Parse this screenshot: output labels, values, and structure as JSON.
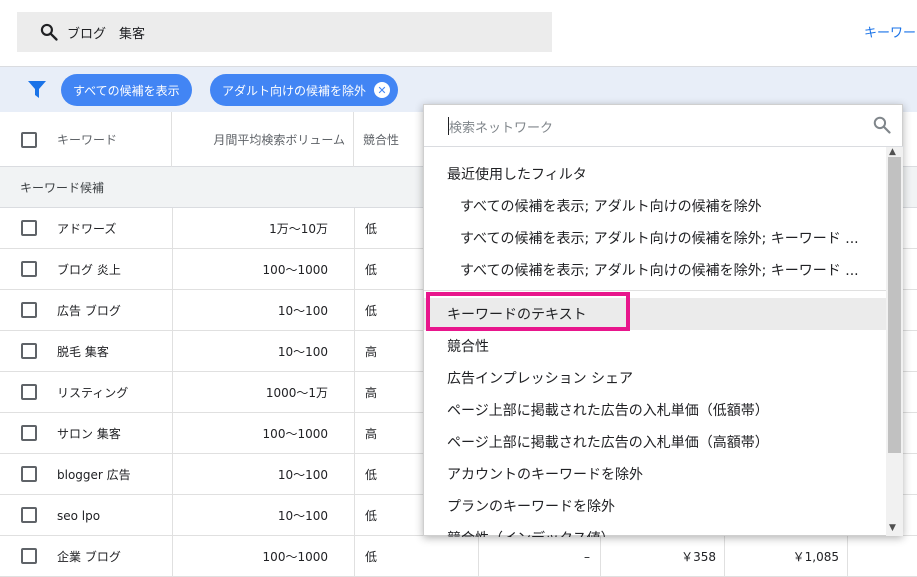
{
  "search": {
    "query": "ブログ　集客"
  },
  "top_link": "キーワー",
  "filters": {
    "chips": [
      "すべての候補を表示",
      "アダルト向けの候補を除外"
    ]
  },
  "table": {
    "headers": [
      "キーワード",
      "月間平均検索ボリューム",
      "競合性"
    ],
    "section_label": "キーワード候補",
    "rows": [
      {
        "keyword": "アドワーズ",
        "volume": "1万～10万",
        "competition": "低"
      },
      {
        "keyword": "ブログ 炎上",
        "volume": "100～1000",
        "competition": "低"
      },
      {
        "keyword": "広告 ブログ",
        "volume": "10～100",
        "competition": "低"
      },
      {
        "keyword": "脱毛 集客",
        "volume": "10～100",
        "competition": "高"
      },
      {
        "keyword": "リスティング",
        "volume": "1000～1万",
        "competition": "高"
      },
      {
        "keyword": "サロン 集客",
        "volume": "100～1000",
        "competition": "高"
      },
      {
        "keyword": "blogger 広告",
        "volume": "10～100",
        "competition": "低"
      },
      {
        "keyword": "seo lpo",
        "volume": "10～100",
        "competition": "低"
      },
      {
        "keyword": "企業 ブログ",
        "volume": "100～1000",
        "competition": "低",
        "share": "–",
        "bid_low": "￥358",
        "bid_high": "￥1,085"
      }
    ]
  },
  "dropdown": {
    "search_placeholder": "検索ネットワーク",
    "items": [
      {
        "label": "最近使用したフィルタ",
        "sub": false
      },
      {
        "label": "すべての候補を表示; アダルト向けの候補を除外",
        "sub": true
      },
      {
        "label": "すべての候補を表示; アダルト向けの候補を除外; キーワード ...",
        "sub": true
      },
      {
        "label": "すべての候補を表示; アダルト向けの候補を除外; キーワード ...",
        "sub": true
      },
      {
        "label": "キーワードのテキスト",
        "sub": false,
        "highlighted": true
      },
      {
        "label": "競合性",
        "sub": false
      },
      {
        "label": "広告インプレッション シェア",
        "sub": false
      },
      {
        "label": "ページ上部に掲載された広告の入札単価（低額帯）",
        "sub": false
      },
      {
        "label": "ページ上部に掲載された広告の入札単価（高額帯）",
        "sub": false
      },
      {
        "label": "アカウントのキーワードを除外",
        "sub": false
      },
      {
        "label": "プランのキーワードを除外",
        "sub": false
      },
      {
        "label": "競合性（インデックス値）",
        "sub": false
      }
    ]
  },
  "colors": {
    "chip": "#4285f4",
    "highlight_box": "#e8168c",
    "link": "#1a73e8"
  }
}
